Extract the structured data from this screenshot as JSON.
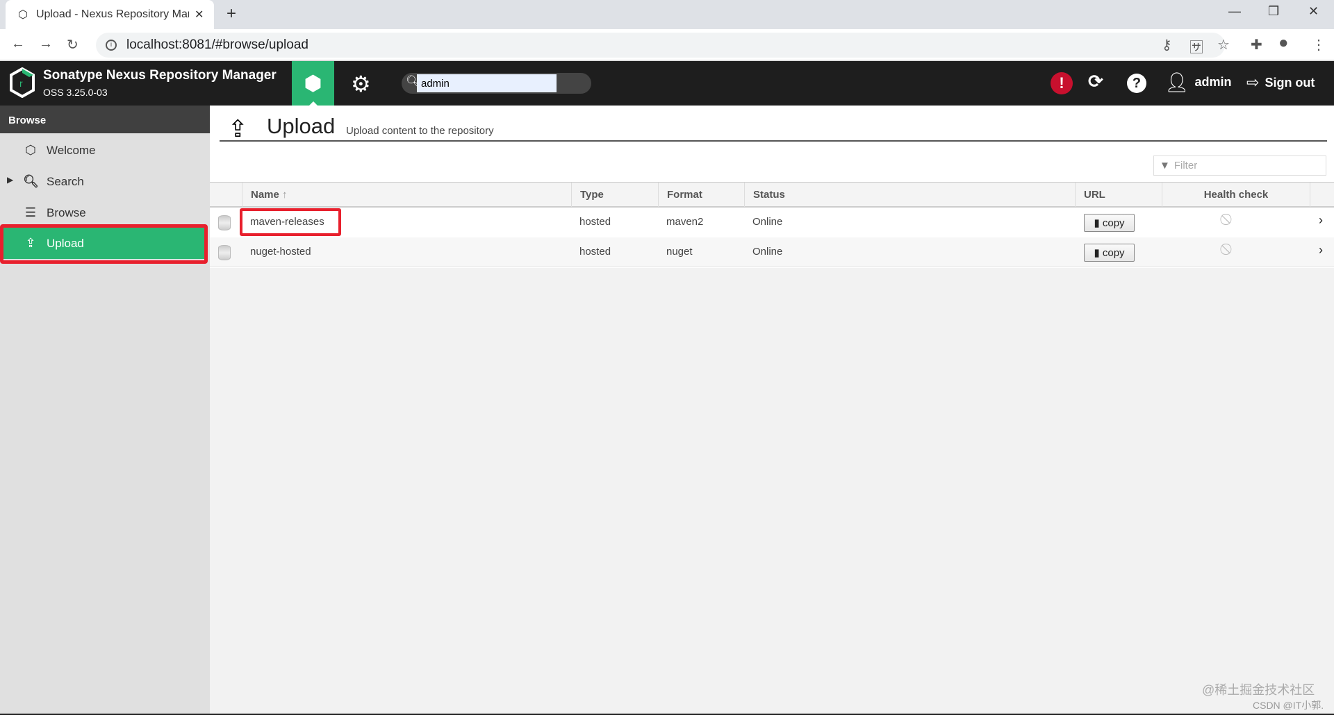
{
  "browser": {
    "tab_title": "Upload - Nexus Repository Manager",
    "url": "localhost:8081/#browse/upload"
  },
  "header": {
    "app_title": "Sonatype Nexus Repository Manager",
    "version": "OSS 3.25.0-03",
    "search_value": "admin",
    "user": "admin",
    "sign_out": "Sign out"
  },
  "sidebar": {
    "section": "Browse",
    "items": [
      {
        "label": "Welcome",
        "icon": "hexagon-icon"
      },
      {
        "label": "Search",
        "icon": "search-icon"
      },
      {
        "label": "Browse",
        "icon": "database-icon"
      },
      {
        "label": "Upload",
        "icon": "upload-icon",
        "active": true
      }
    ]
  },
  "page": {
    "title": "Upload",
    "subtitle": "Upload content to the repository",
    "filter_placeholder": "Filter"
  },
  "table": {
    "columns": [
      "Name",
      "Type",
      "Format",
      "Status",
      "URL",
      "Health check"
    ],
    "rows": [
      {
        "name": "maven-releases",
        "type": "hosted",
        "format": "maven2",
        "status": "Online",
        "url_button": "copy"
      },
      {
        "name": "nuget-hosted",
        "type": "hosted",
        "format": "nuget",
        "status": "Online",
        "url_button": "copy"
      }
    ]
  },
  "watermark": {
    "line1": "@稀土掘金技术社区",
    "line2": "CSDN @IT小郭."
  },
  "colors": {
    "accent": "#2ab673",
    "header_bg": "#1e1e1e",
    "alert": "#c8102e",
    "highlight_box": "#e8202d"
  }
}
